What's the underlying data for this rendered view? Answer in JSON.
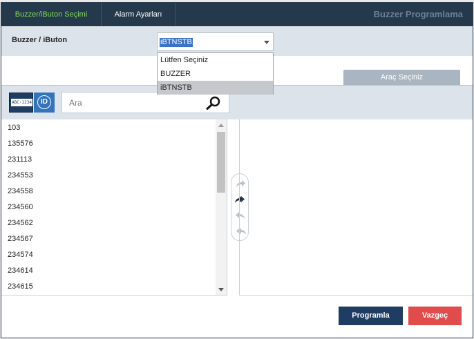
{
  "tabs": [
    {
      "label": "Buzzer/iButon Seçimi",
      "active": true
    },
    {
      "label": "Alarm Ayarları",
      "active": false
    }
  ],
  "header": {
    "title": "Buzzer Programlama"
  },
  "selector": {
    "label": "Buzzer / iButon",
    "selected": "iBTNSTB",
    "options": [
      "Lütfen Seçiniz",
      "BUZZER",
      "iBTNSTB"
    ]
  },
  "vehicle_tab": {
    "label": "Araç Seçiniz"
  },
  "badges": {
    "plate_text": "ABC·1234",
    "id_text": "ID"
  },
  "search": {
    "placeholder": "Ara",
    "icon": "search-icon"
  },
  "list": {
    "items": [
      "103",
      "135576",
      "231113",
      "234553",
      "234558",
      "234560",
      "234562",
      "234567",
      "234574",
      "234614",
      "234615"
    ]
  },
  "transfer_icons": [
    "move-right-icon",
    "move-all-right-icon",
    "move-left-icon",
    "move-all-left-icon"
  ],
  "actions": {
    "program_label": "Programla",
    "cancel_label": "Vazgeç"
  },
  "colors": {
    "header_bg": "#25394d",
    "active_tab": "#7ddc4f",
    "primary": "#1f3d63",
    "danger": "#e04b4b"
  }
}
